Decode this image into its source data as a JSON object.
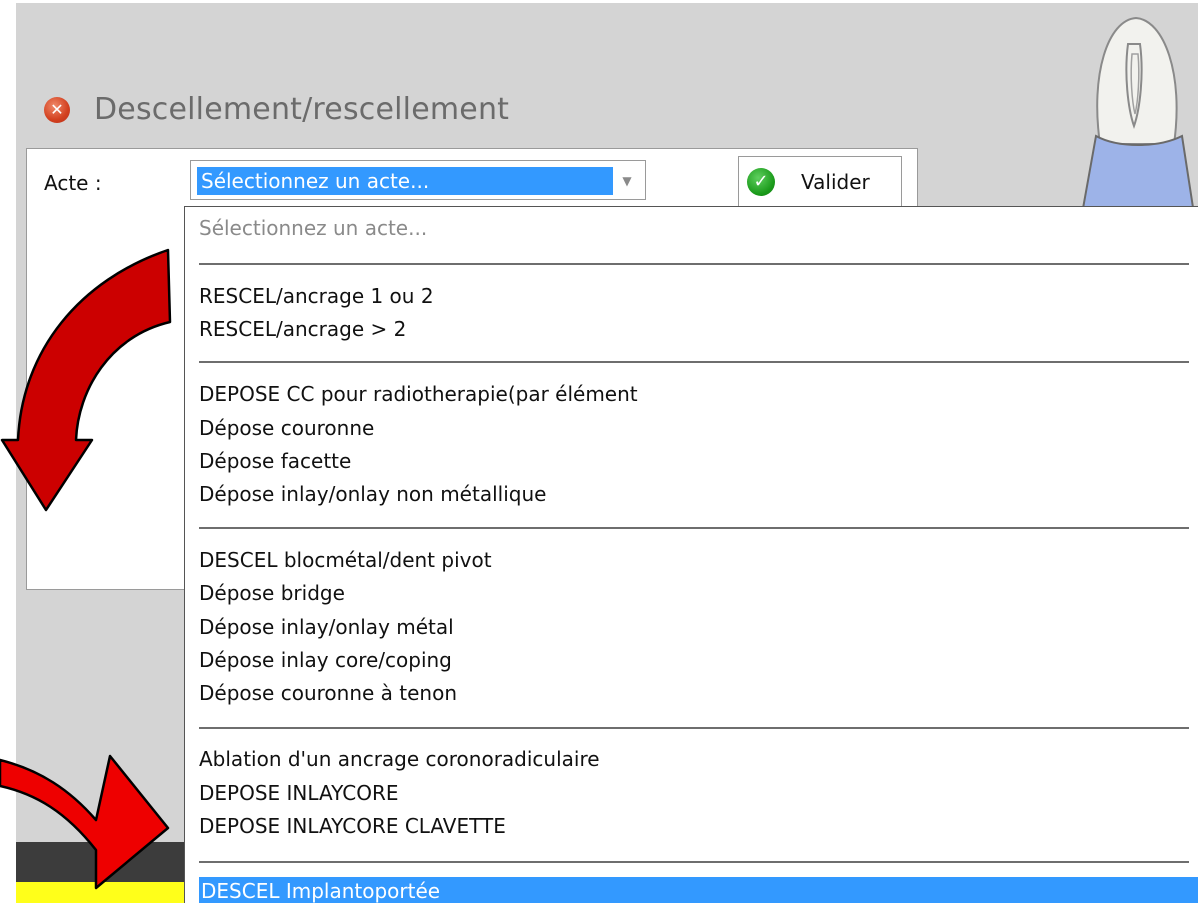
{
  "dialog": {
    "title": "Descellement/rescellement",
    "close_icon": "close-icon"
  },
  "form": {
    "acte_label": "Acte :",
    "select_value": "Sélectionnez un acte...",
    "validate_label": "Valider"
  },
  "dropdown": {
    "placeholder": "Sélectionnez un acte...",
    "groups": [
      [
        "RESCEL/ancrage 1 ou 2",
        "RESCEL/ancrage > 2"
      ],
      [
        "DEPOSE CC pour radiotherapie(par élément",
        "Dépose couronne",
        "Dépose facette",
        "Dépose inlay/onlay non métallique"
      ],
      [
        "DESCEL blocmétal/dent pivot",
        "Dépose bridge",
        "Dépose inlay/onlay métal",
        "Dépose inlay core/coping",
        "Dépose couronne à tenon"
      ],
      [
        "Ablation d'un ancrage coronoradiculaire",
        "DEPOSE INLAYCORE",
        "DEPOSE INLAYCORE CLAVETTE"
      ]
    ],
    "selected": "DESCEL Implantoportée"
  },
  "colors": {
    "selection": "#3399ff",
    "arrow_red": "#e00000",
    "tooth_blue": "#9db3e8",
    "highlight_yellow": "#ffff1a"
  }
}
